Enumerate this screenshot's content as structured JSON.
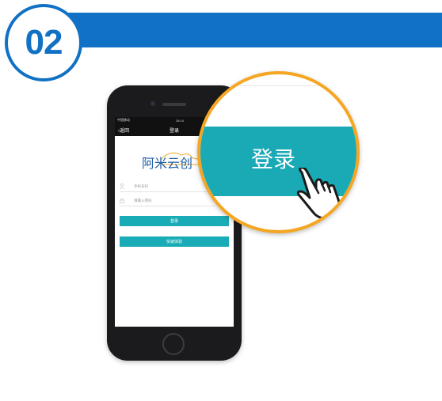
{
  "step": {
    "number": "02"
  },
  "colors": {
    "brand_blue": "#1171c4",
    "teal": "#1aacb6",
    "orange": "#f5a623"
  },
  "phone": {
    "status": {
      "carrier": "中国移动",
      "time": "15:14"
    },
    "nav": {
      "back_label": "返回",
      "title": "登录"
    },
    "logo_text": "阿米云创",
    "form": {
      "phone_placeholder": "手机号码",
      "password_placeholder": "请输入密码",
      "login_label": "登录",
      "quick_label": "快速体验"
    }
  },
  "magnifier": {
    "label": "登录"
  }
}
